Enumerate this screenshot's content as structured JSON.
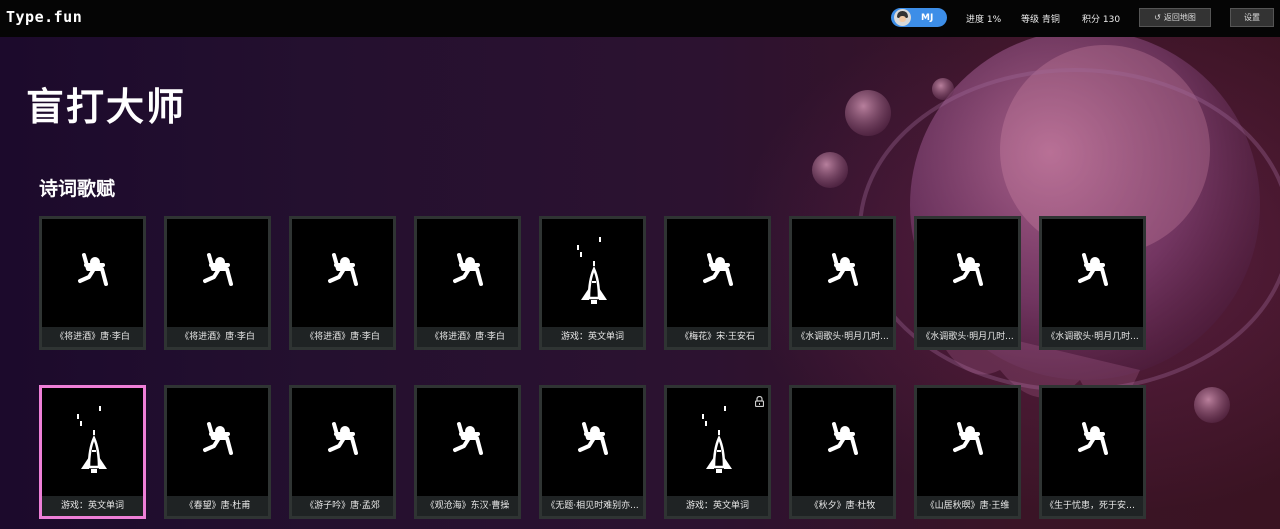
{
  "app": {
    "logo": "Type.fun"
  },
  "header": {
    "user": "MJ",
    "progress": "进度 1%",
    "level": "等级 青铜",
    "points": "积分 130",
    "back_button": "返回地图",
    "settings_button": "设置"
  },
  "page": {
    "title": "盲打大师",
    "section": "诗词歌赋"
  },
  "cards": [
    {
      "label": "《将进酒》唐·李白",
      "icon": "typing-pose-icon",
      "locked": false,
      "selected": false
    },
    {
      "label": "《将进酒》唐·李白",
      "icon": "typing-pose-icon",
      "locked": false,
      "selected": false
    },
    {
      "label": "《将进酒》唐·李白",
      "icon": "typing-pose-icon",
      "locked": false,
      "selected": false
    },
    {
      "label": "《将进酒》唐·李白",
      "icon": "typing-pose-icon",
      "locked": false,
      "selected": false
    },
    {
      "label": "游戏：英文单词",
      "icon": "rocket-icon",
      "locked": false,
      "selected": false
    },
    {
      "label": "《梅花》宋·王安石",
      "icon": "typing-pose-icon",
      "locked": false,
      "selected": false
    },
    {
      "label": "《水调歌头·明月几时...",
      "icon": "typing-pose-icon",
      "locked": false,
      "selected": false
    },
    {
      "label": "《水调歌头·明月几时...",
      "icon": "typing-pose-icon",
      "locked": false,
      "selected": false
    },
    {
      "label": "《水调歌头·明月几时...",
      "icon": "typing-pose-icon",
      "locked": false,
      "selected": false
    },
    {
      "label": "游戏：英文单词",
      "icon": "rocket-icon",
      "locked": false,
      "selected": true
    },
    {
      "label": "《春望》唐·杜甫",
      "icon": "typing-pose-icon",
      "locked": false,
      "selected": false
    },
    {
      "label": "《游子吟》唐·孟郊",
      "icon": "typing-pose-icon",
      "locked": false,
      "selected": false
    },
    {
      "label": "《观沧海》东汉·曹操",
      "icon": "typing-pose-icon",
      "locked": false,
      "selected": false
    },
    {
      "label": "《无题·相见时难别亦...",
      "icon": "typing-pose-icon",
      "locked": false,
      "selected": false
    },
    {
      "label": "游戏：英文单词",
      "icon": "rocket-icon",
      "locked": true,
      "selected": false
    },
    {
      "label": "《秋夕》唐·杜牧",
      "icon": "typing-pose-icon",
      "locked": false,
      "selected": false
    },
    {
      "label": "《山居秋暝》唐·王维",
      "icon": "typing-pose-icon",
      "locked": false,
      "selected": false
    },
    {
      "label": "《生于忧患，死于安乐...",
      "icon": "typing-pose-icon",
      "locked": false,
      "selected": false
    }
  ]
}
